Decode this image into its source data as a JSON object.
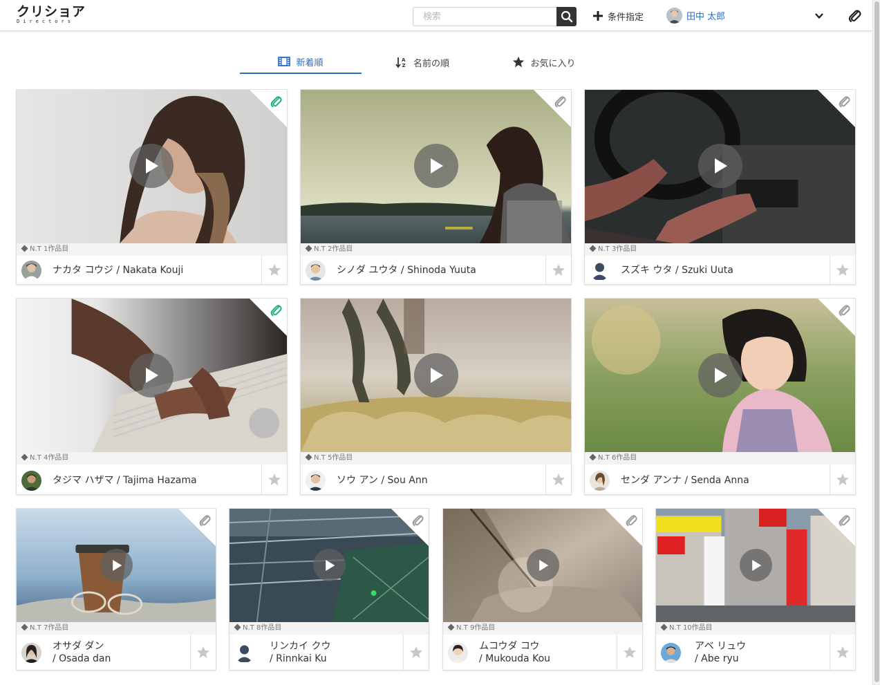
{
  "header": {
    "logo_main": "クリショア",
    "logo_sub": "Directors",
    "search_placeholder": "検索",
    "condition_label": "条件指定",
    "user_name": "田中 太郎"
  },
  "tabs": [
    {
      "label": "新着順",
      "icon": "film-icon",
      "active": true
    },
    {
      "label": "名前の順",
      "icon": "sort-az-icon",
      "active": false
    },
    {
      "label": "お気に入り",
      "icon": "star-icon",
      "active": false
    }
  ],
  "cards": [
    {
      "label": "N.T 1作品目",
      "name": "ナカタ コウジ / Nakata Kouji",
      "attachment_color": "#1bb08a"
    },
    {
      "label": "N.T 2作品目",
      "name": "シノダ ユウタ / Shinoda Yuuta",
      "attachment_color": "#9a9a9a"
    },
    {
      "label": "N.T 3作品目",
      "name": "スズキ ウタ / Szuki Uuta",
      "attachment_color": "#9a9a9a"
    },
    {
      "label": "N.T 4作品目",
      "name": "タジマ ハザマ / Tajima Hazama",
      "attachment_color": "#1bb08a"
    },
    {
      "label": "N.T 5作品目",
      "name": "ソウ アン / Sou Ann",
      "attachment_color": "#9a9a9a"
    },
    {
      "label": "N.T 6作品目",
      "name": "センダ アンナ / Senda Anna",
      "attachment_color": "#9a9a9a"
    },
    {
      "label": "N.T 7作品目",
      "name_line1": "オサダ ダン",
      "name_line2": "/ Osada dan",
      "attachment_color": "#9a9a9a"
    },
    {
      "label": "N.T 8作品目",
      "name_line1": "リンカイ クウ",
      "name_line2": "/ Rinnkai Ku",
      "attachment_color": "#9a9a9a"
    },
    {
      "label": "N.T 9作品目",
      "name_line1": "ムコウダ コウ",
      "name_line2": "/ Mukouda Kou",
      "attachment_color": "#9a9a9a"
    },
    {
      "label": "N.T 10作品目",
      "name_line1": "アベ リュウ",
      "name_line2": "/ Abe ryu",
      "attachment_color": "#9a9a9a"
    }
  ],
  "colors": {
    "accent": "#2a6fc9",
    "attachment_active": "#1bb08a"
  }
}
